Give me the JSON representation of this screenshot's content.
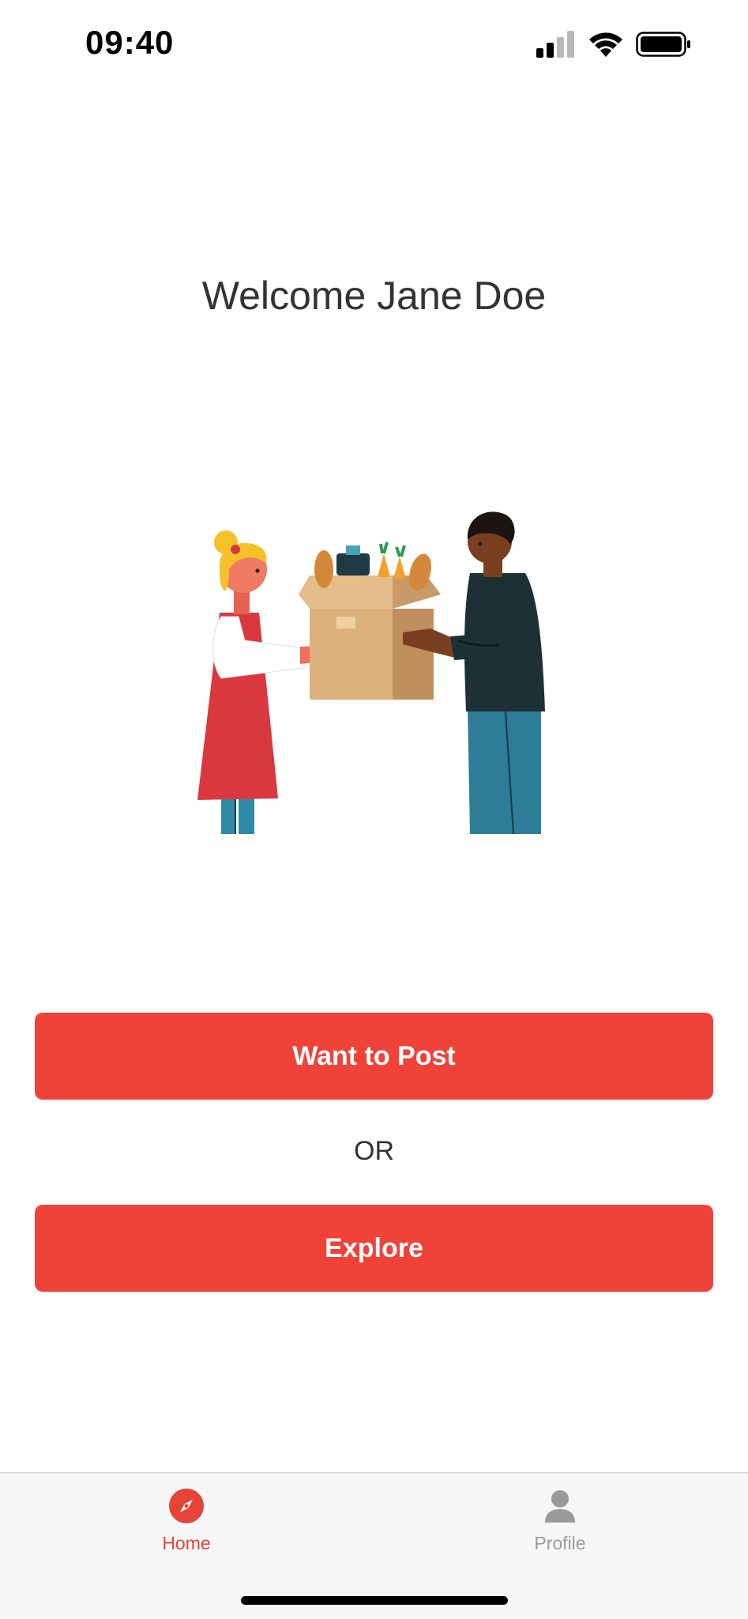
{
  "status_bar": {
    "time": "09:40",
    "icons": [
      "cellular-signal-icon",
      "wifi-icon",
      "battery-icon"
    ]
  },
  "main": {
    "title": "Welcome Jane Doe",
    "illustration": "people-exchanging-food-box-illustration",
    "post_button_label": "Want to Post",
    "or_label": "OR",
    "explore_button_label": "Explore"
  },
  "tab_bar": {
    "tabs": [
      {
        "label": "Home",
        "icon": "compass-icon",
        "active": true
      },
      {
        "label": "Profile",
        "icon": "person-icon",
        "active": false
      }
    ]
  },
  "colors": {
    "accent": "#ef4339",
    "active_tab": "#e64339",
    "inactive_tab": "#9a9a9a",
    "tab_bar_bg": "#f7f7f7"
  }
}
